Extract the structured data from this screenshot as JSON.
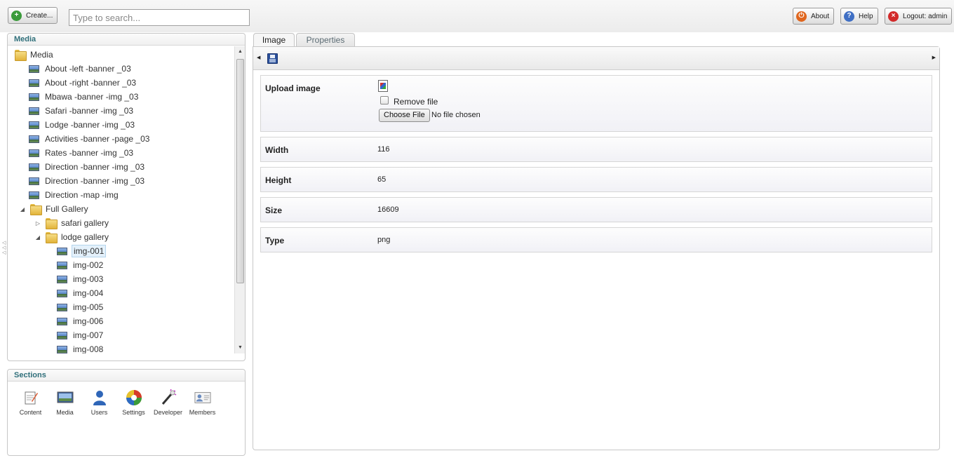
{
  "topbar": {
    "create_label": "Create...",
    "search_placeholder": "Type to search...",
    "about_label": "About",
    "help_label": "Help",
    "logout_label": "Logout: admin"
  },
  "media_panel": {
    "title": "Media",
    "tree": [
      {
        "label": "Media",
        "type": "folder"
      },
      {
        "label": "About -left -banner _03",
        "type": "image"
      },
      {
        "label": "About -right -banner _03",
        "type": "image"
      },
      {
        "label": "Mbawa -banner -img _03",
        "type": "image"
      },
      {
        "label": "Safari -banner -img _03",
        "type": "image"
      },
      {
        "label": "Lodge -banner -img _03",
        "type": "image"
      },
      {
        "label": "Activities -banner -page _03",
        "type": "image"
      },
      {
        "label": "Rates -banner -img _03",
        "type": "image"
      },
      {
        "label": "Direction -banner -img _03",
        "type": "image"
      },
      {
        "label": "Direction -banner -img _03",
        "type": "image"
      },
      {
        "label": "Direction -map -img",
        "type": "image"
      },
      {
        "label": "Full Gallery",
        "type": "folder",
        "expanded": true
      },
      {
        "label": "safari gallery",
        "type": "folder",
        "expanded": false
      },
      {
        "label": "lodge gallery",
        "type": "folder",
        "expanded": true
      },
      {
        "label": "img-001",
        "type": "image",
        "selected": true
      },
      {
        "label": "img-002",
        "type": "image"
      },
      {
        "label": "img-003",
        "type": "image"
      },
      {
        "label": "img-004",
        "type": "image"
      },
      {
        "label": "img-005",
        "type": "image"
      },
      {
        "label": "img-006",
        "type": "image"
      },
      {
        "label": "img-007",
        "type": "image"
      },
      {
        "label": "img-008",
        "type": "image"
      }
    ]
  },
  "sections_panel": {
    "title": "Sections",
    "items": [
      {
        "label": "Content",
        "icon": "content-icon"
      },
      {
        "label": "Media",
        "icon": "media-icon"
      },
      {
        "label": "Users",
        "icon": "users-icon"
      },
      {
        "label": "Settings",
        "icon": "settings-icon"
      },
      {
        "label": "Developer",
        "icon": "developer-icon"
      },
      {
        "label": "Members",
        "icon": "members-icon"
      }
    ]
  },
  "tabs": [
    {
      "label": "Image",
      "active": true
    },
    {
      "label": "Properties",
      "active": false
    }
  ],
  "image_form": {
    "upload_label": "Upload image",
    "remove_file_label": "Remove file",
    "choose_file_label": "Choose File",
    "no_file_text": "No file chosen",
    "fields": [
      {
        "label": "Width",
        "value": "116"
      },
      {
        "label": "Height",
        "value": "65"
      },
      {
        "label": "Size",
        "value": "16609"
      },
      {
        "label": "Type",
        "value": "png"
      }
    ]
  },
  "colors": {
    "panel_title": "#2f6f7a",
    "create_icon": "#3a9a3a",
    "about_icon": "#e0661e",
    "help_icon": "#3f6fc4",
    "logout_icon": "#d22a2a"
  }
}
